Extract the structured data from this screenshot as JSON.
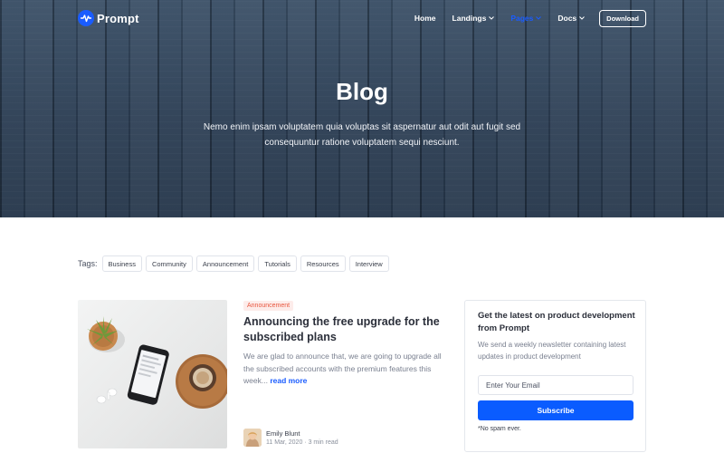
{
  "brand": {
    "name": "Prompt",
    "accent": "#1a5cff"
  },
  "nav": {
    "items": [
      {
        "label": "Home",
        "has_dropdown": false,
        "active": false
      },
      {
        "label": "Landings",
        "has_dropdown": true,
        "active": false
      },
      {
        "label": "Pages",
        "has_dropdown": true,
        "active": true
      },
      {
        "label": "Docs",
        "has_dropdown": true,
        "active": false
      }
    ],
    "download_label": "Download"
  },
  "hero": {
    "title": "Blog",
    "subtitle": "Nemo enim ipsam voluptatem quia voluptas sit aspernatur aut odit aut fugit sed consequuntur ratione voluptatem sequi nesciunt."
  },
  "tags": {
    "label": "Tags:",
    "items": [
      "Business",
      "Community",
      "Announcement",
      "Tutorials",
      "Resources",
      "Interview"
    ]
  },
  "post": {
    "badge": "Announcement",
    "title": "Announcing the free upgrade for the subscribed plans",
    "excerpt": "We are glad to announce that, we are going to upgrade all the subscribed accounts with the premium features this week...",
    "read_more": "read more",
    "author": "Emily Blunt",
    "meta": "11 Mar, 2020 · 3 min read"
  },
  "newsletter": {
    "title": "Get the latest on product development from Prompt",
    "description": "We send a weekly newsletter containing latest updates in product development",
    "email_placeholder": "Enter Your Email",
    "button_label": "Subscribe",
    "note": "*No spam ever."
  }
}
